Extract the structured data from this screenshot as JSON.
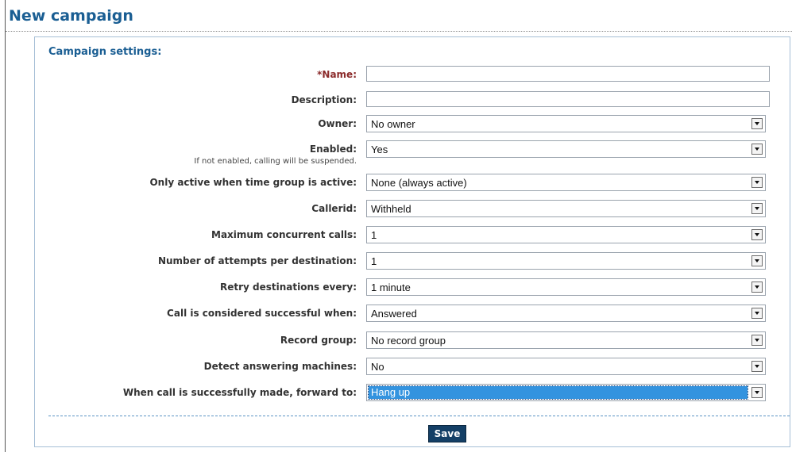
{
  "page": {
    "title": "New campaign"
  },
  "section": {
    "header": "Campaign settings:"
  },
  "fields": {
    "name": {
      "label": "*Name:",
      "value": ""
    },
    "description": {
      "label": "Description:",
      "value": ""
    },
    "owner": {
      "label": "Owner:",
      "selected": "No owner"
    },
    "enabled": {
      "label": "Enabled:",
      "help": "If not enabled, calling will be suspended.",
      "selected": "Yes"
    },
    "time_group": {
      "label": "Only active when time group is active:",
      "selected": "None (always active)"
    },
    "callerid": {
      "label": "Callerid:",
      "selected": "Withheld"
    },
    "max_concurrent": {
      "label": "Maximum concurrent calls:",
      "selected": "1"
    },
    "attempts": {
      "label": "Number of attempts per destination:",
      "selected": "1"
    },
    "retry": {
      "label": "Retry destinations every:",
      "selected": "1 minute"
    },
    "success": {
      "label": "Call is considered successful when:",
      "selected": "Answered"
    },
    "record_group": {
      "label": "Record group:",
      "selected": "No record group"
    },
    "detect_am": {
      "label": "Detect answering machines:",
      "selected": "No"
    },
    "forward": {
      "label": "When call is successfully made, forward to:",
      "selected": "Hang up"
    }
  },
  "actions": {
    "save_label": "Save"
  },
  "colors": {
    "title": "#1a5e93",
    "required_label": "#8b2b2b",
    "selection_highlight": "#3393df",
    "save_button": "#143f66"
  }
}
